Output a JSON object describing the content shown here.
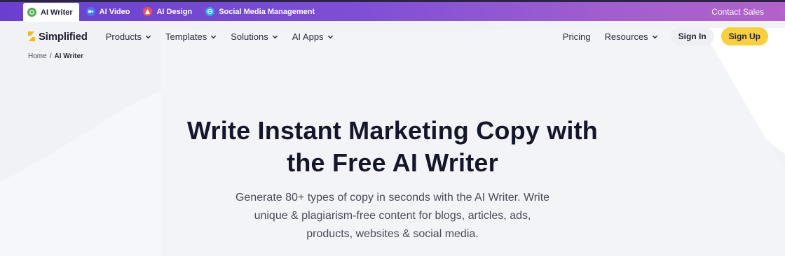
{
  "topbar": {
    "tabs": [
      {
        "label": "AI Writer",
        "icon": "ai-writer-icon",
        "color": "#4caf50",
        "active": true
      },
      {
        "label": "AI Video",
        "icon": "ai-video-icon",
        "color": "#3d7bf0",
        "active": false
      },
      {
        "label": "AI Design",
        "icon": "ai-design-icon",
        "color": "#f0563d",
        "active": false
      },
      {
        "label": "Social Media Management",
        "icon": "social-media-icon",
        "color": "#29a8e0",
        "active": false
      }
    ],
    "contact_label": "Contact Sales"
  },
  "nav": {
    "logo_text": "Simplified",
    "menu": [
      {
        "label": "Products"
      },
      {
        "label": "Templates"
      },
      {
        "label": "Solutions"
      },
      {
        "label": "AI Apps"
      }
    ],
    "pricing_label": "Pricing",
    "resources_label": "Resources",
    "signin_label": "Sign In",
    "signup_label": "Sign Up"
  },
  "breadcrumb": {
    "home": "Home",
    "separator": "/",
    "current": "AI Writer"
  },
  "hero": {
    "title_line1": "Write Instant Marketing Copy with",
    "title_line2": "the Free AI Writer",
    "subtitle_line1": "Generate 80+ types of copy in seconds with the AI Writer. Write",
    "subtitle_line2": "unique & plagiarism-free content for blogs, articles, ads,",
    "subtitle_line3": "products, websites & social media."
  },
  "colors": {
    "accent": "#f9cf3b",
    "topbar_start": "#6a3fd0",
    "topbar_end": "#b262c9"
  }
}
